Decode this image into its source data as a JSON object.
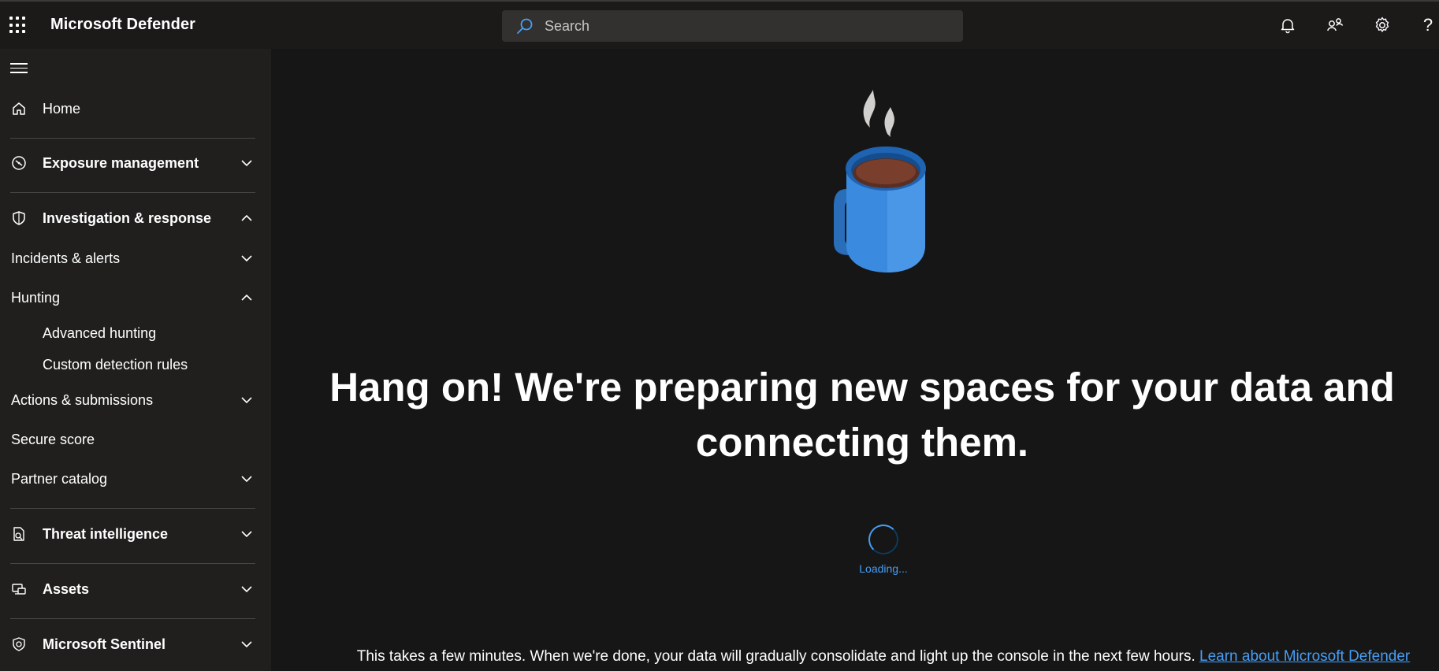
{
  "header": {
    "app_title": "Microsoft Defender",
    "search_placeholder": "Search",
    "help_glyph": "?",
    "icons": [
      "waffle-icon",
      "search-icon",
      "bell-icon",
      "people-icon",
      "gear-icon",
      "help-icon"
    ]
  },
  "sidebar": {
    "items": [
      {
        "label": "Home",
        "icon": "home-icon",
        "chevron": "none"
      },
      {
        "label": "Exposure management",
        "icon": "compass-icon",
        "chevron": "down"
      },
      {
        "label": "Investigation & response",
        "icon": "shield-icon",
        "chevron": "up"
      },
      {
        "label": "Incidents & alerts",
        "chevron": "down"
      },
      {
        "label": "Hunting",
        "chevron": "up"
      },
      {
        "label": "Advanced hunting",
        "chevron": "none"
      },
      {
        "label": "Custom detection rules",
        "chevron": "none"
      },
      {
        "label": "Actions & submissions",
        "chevron": "down"
      },
      {
        "label": "Secure score",
        "chevron": "none"
      },
      {
        "label": "Partner catalog",
        "chevron": "down"
      },
      {
        "label": "Threat intelligence",
        "icon": "threat-intel-icon",
        "chevron": "down"
      },
      {
        "label": "Assets",
        "icon": "assets-icon",
        "chevron": "down"
      },
      {
        "label": "Microsoft Sentinel",
        "icon": "sentinel-icon",
        "chevron": "down"
      }
    ]
  },
  "main": {
    "headline": "Hang on! We're preparing new spaces for your data and connecting them.",
    "loading_text": "Loading...",
    "info_text": "This takes a few minutes. When we're done, your data will gradually consolidate and light up the console in the next few hours. ",
    "link_text": "Learn about Microsoft Defender XDR"
  },
  "colors": {
    "accent": "#479ef5",
    "background": "#161616",
    "sidebar": "#201f1e",
    "topbar": "#1b1a19"
  }
}
